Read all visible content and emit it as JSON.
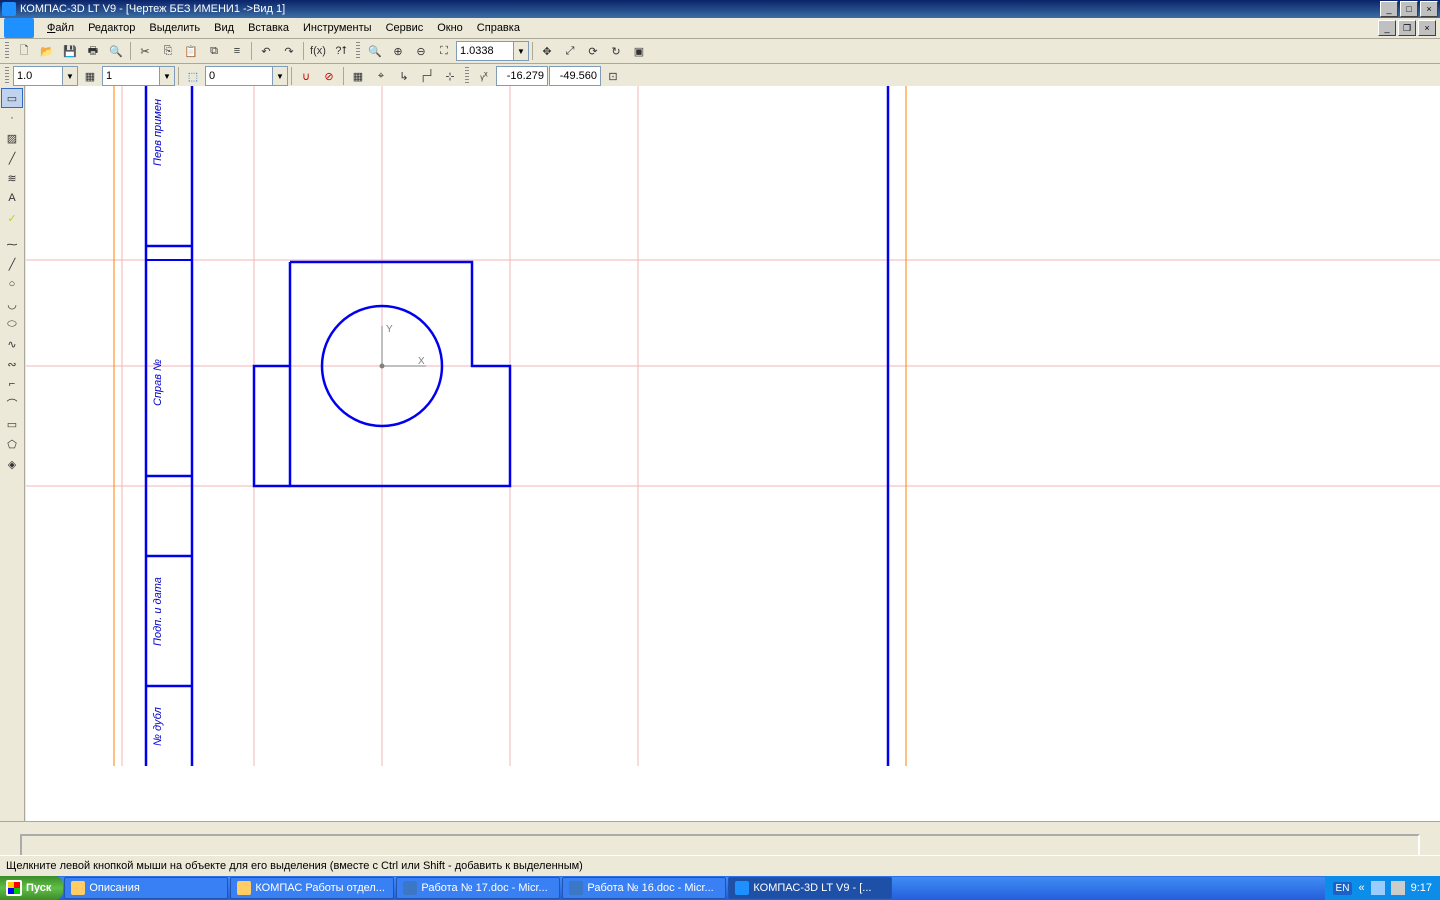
{
  "title": "КОМПАС-3D LT V9 - [Чертеж БЕЗ ИМЕНИ1 ->Вид 1]",
  "menu": {
    "file": "Файл",
    "edit": "Редактор",
    "select": "Выделить",
    "view": "Вид",
    "insert": "Вставка",
    "tools": "Инструменты",
    "service": "Сервис",
    "window": "Окно",
    "help": "Справка"
  },
  "tb2": {
    "linewidth": "1.0",
    "style": "1",
    "layer": "0"
  },
  "zoom": "1.0338",
  "coords": {
    "x": "-16.279",
    "y": "-49.560"
  },
  "axes": {
    "x": "X",
    "y": "Y"
  },
  "notes": {
    "a": "Перв примен",
    "b": "Справ №",
    "c": "Подп. и дата",
    "d": "№ дубл"
  },
  "status": "Щелкните левой кнопкой мыши на объекте для его выделения (вместе с Ctrl или Shift - добавить к выделенным)",
  "task": {
    "start": "Пуск",
    "b1": "Описания",
    "b2": "КОМПАС Работы отдел...",
    "b3": "Работа № 17.doc - Micr...",
    "b4": "Работа № 16.doc - Micr...",
    "b5": "КОМПАС-3D LT V9 - [..."
  },
  "tray": {
    "lang": "EN",
    "time": "9:17"
  }
}
